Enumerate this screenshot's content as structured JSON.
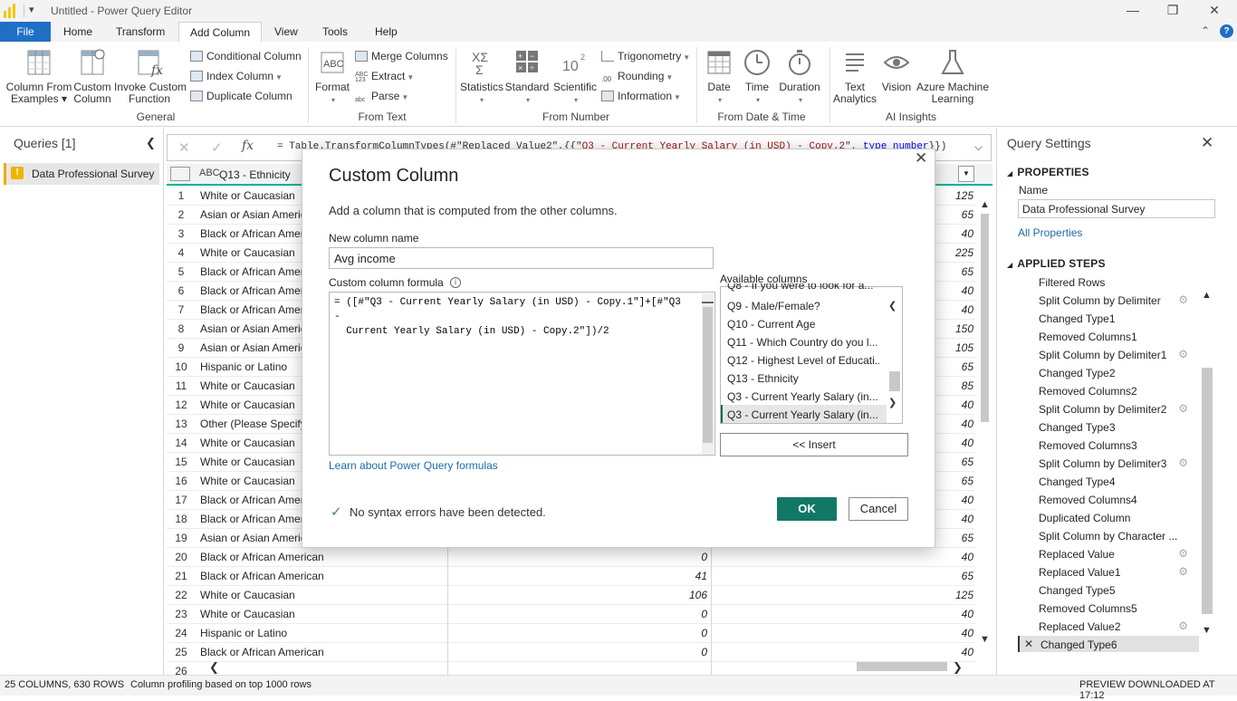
{
  "window": {
    "title": "Untitled - Power Query Editor",
    "qa_menu": "▾",
    "controls": [
      "—",
      "❐",
      "✕"
    ]
  },
  "tabs": [
    "File",
    "Home",
    "Transform",
    "Add Column",
    "View",
    "Tools",
    "Help"
  ],
  "active_tab": "Add Column",
  "ribbon": {
    "general": {
      "label": "General",
      "buttons": [
        "Column From\nExamples ▾",
        "Custom\nColumn",
        "Invoke Custom\nFunction"
      ],
      "small": [
        "Conditional Column",
        "Index Column",
        "Duplicate Column"
      ]
    },
    "from_text": {
      "label": "From Text",
      "format": "Format",
      "small": [
        "Merge Columns",
        "Extract",
        "Parse"
      ]
    },
    "from_number": {
      "label": "From Number",
      "buttons": [
        "Statistics",
        "Standard",
        "Scientific"
      ],
      "small": [
        "Trigonometry",
        "Rounding",
        "Information"
      ]
    },
    "from_date_time": {
      "label": "From Date & Time",
      "buttons": [
        "Date",
        "Time",
        "Duration"
      ]
    },
    "ai_insights": {
      "label": "AI Insights",
      "buttons": [
        "Text\nAnalytics",
        "Vision",
        "Azure Machine\nLearning"
      ]
    }
  },
  "queries": {
    "title": "Queries [1]",
    "items": [
      "Data Professional Survey"
    ]
  },
  "formula_bar": {
    "prefix": "= Table.TransformColumnTypes(#\"Replaced Value2\",{{\"",
    "string": "Q3 - Current Yearly Salary (in USD) - Copy.2",
    "mid": "\", ",
    "keyword": "type number",
    "suffix": "}})"
  },
  "grid": {
    "column_type": "ABC",
    "column_name": "Q13 - Ethnicity",
    "rows": [
      {
        "n": "1",
        "c1": "White or Caucasian",
        "c2": "",
        "c3": "125"
      },
      {
        "n": "2",
        "c1": "Asian or Asian American",
        "c2": "",
        "c3": "65"
      },
      {
        "n": "3",
        "c1": "Black or African American",
        "c2": "",
        "c3": "40"
      },
      {
        "n": "4",
        "c1": "White or Caucasian",
        "c2": "",
        "c3": "225"
      },
      {
        "n": "5",
        "c1": "Black or African American",
        "c2": "",
        "c3": "65"
      },
      {
        "n": "6",
        "c1": "Black or African American",
        "c2": "",
        "c3": "40"
      },
      {
        "n": "7",
        "c1": "Black or African American",
        "c2": "",
        "c3": "40"
      },
      {
        "n": "8",
        "c1": "Asian or Asian American",
        "c2": "",
        "c3": "150"
      },
      {
        "n": "9",
        "c1": "Asian or Asian American",
        "c2": "",
        "c3": "105"
      },
      {
        "n": "10",
        "c1": "Hispanic or Latino",
        "c2": "",
        "c3": "65"
      },
      {
        "n": "11",
        "c1": "White or Caucasian",
        "c2": "",
        "c3": "85"
      },
      {
        "n": "12",
        "c1": "White or Caucasian",
        "c2": "",
        "c3": "40"
      },
      {
        "n": "13",
        "c1": "Other (Please Specify):",
        "c2": "",
        "c3": "40"
      },
      {
        "n": "14",
        "c1": "White or Caucasian",
        "c2": "",
        "c3": "40"
      },
      {
        "n": "15",
        "c1": "White or Caucasian",
        "c2": "",
        "c3": "65"
      },
      {
        "n": "16",
        "c1": "White or Caucasian",
        "c2": "",
        "c3": "65"
      },
      {
        "n": "17",
        "c1": "Black or African American",
        "c2": "",
        "c3": "40"
      },
      {
        "n": "18",
        "c1": "Black or African American",
        "c2": "",
        "c3": "40"
      },
      {
        "n": "19",
        "c1": "Asian or Asian American",
        "c2": "",
        "c3": "65"
      },
      {
        "n": "20",
        "c1": "Black or African American",
        "c2": "0",
        "c3": "40"
      },
      {
        "n": "21",
        "c1": "Black or African American",
        "c2": "41",
        "c3": "65"
      },
      {
        "n": "22",
        "c1": "White or Caucasian",
        "c2": "106",
        "c3": "125"
      },
      {
        "n": "23",
        "c1": "White or Caucasian",
        "c2": "0",
        "c3": "40"
      },
      {
        "n": "24",
        "c1": "Hispanic or Latino",
        "c2": "0",
        "c3": "40"
      },
      {
        "n": "25",
        "c1": "Black or African American",
        "c2": "0",
        "c3": "40"
      },
      {
        "n": "26",
        "c1": "",
        "c2": "",
        "c3": ""
      }
    ]
  },
  "settings": {
    "title": "Query Settings",
    "properties_head": "PROPERTIES",
    "name_label": "Name",
    "name_value": "Data Professional Survey",
    "all_properties": "All Properties",
    "steps_head": "APPLIED STEPS",
    "steps": [
      {
        "label": "Filtered Rows",
        "gear": false
      },
      {
        "label": "Split Column by Delimiter",
        "gear": true
      },
      {
        "label": "Changed Type1",
        "gear": false
      },
      {
        "label": "Removed Columns1",
        "gear": false
      },
      {
        "label": "Split Column by Delimiter1",
        "gear": true
      },
      {
        "label": "Changed Type2",
        "gear": false
      },
      {
        "label": "Removed Columns2",
        "gear": false
      },
      {
        "label": "Split Column by Delimiter2",
        "gear": true
      },
      {
        "label": "Changed Type3",
        "gear": false
      },
      {
        "label": "Removed Columns3",
        "gear": false
      },
      {
        "label": "Split Column by Delimiter3",
        "gear": true
      },
      {
        "label": "Changed Type4",
        "gear": false
      },
      {
        "label": "Removed Columns4",
        "gear": false
      },
      {
        "label": "Duplicated Column",
        "gear": false
      },
      {
        "label": "Split Column by Character ...",
        "gear": false
      },
      {
        "label": "Replaced Value",
        "gear": true
      },
      {
        "label": "Replaced Value1",
        "gear": true
      },
      {
        "label": "Changed Type5",
        "gear": false
      },
      {
        "label": "Removed Columns5",
        "gear": false
      },
      {
        "label": "Replaced Value2",
        "gear": true
      },
      {
        "label": "Changed Type6",
        "gear": false,
        "selected": true
      }
    ]
  },
  "status": {
    "left": "25 COLUMNS, 630 ROWS",
    "profile": "Column profiling based on top 1000 rows",
    "right": "PREVIEW DOWNLOADED AT 17:12"
  },
  "dialog": {
    "title": "Custom Column",
    "description": "Add a column that is computed from the other columns.",
    "new_column_label": "New column name",
    "new_column_value": "Avg income",
    "formula_label": "Custom column formula",
    "formula": "= ([#\"Q3 - Current Yearly Salary (in USD) - Copy.1\"]+[#\"Q3 -\n  Current Yearly Salary (in USD) - Copy.2\"])/2",
    "learn_link": "Learn about Power Query formulas",
    "available_label": "Available columns",
    "available": [
      "Q8 - If you were to look for a...",
      "Q9 - Male/Female?",
      "Q10 - Current Age",
      "Q11 - Which Country do you l...",
      "Q12 - Highest Level of Educati...",
      "Q13 - Ethnicity",
      "Q3 - Current Yearly Salary (in...",
      "Q3 - Current Yearly Salary (in..."
    ],
    "insert_label": "<< Insert",
    "syntax_message": "No syntax errors have been detected.",
    "ok_label": "OK",
    "cancel_label": "Cancel"
  }
}
